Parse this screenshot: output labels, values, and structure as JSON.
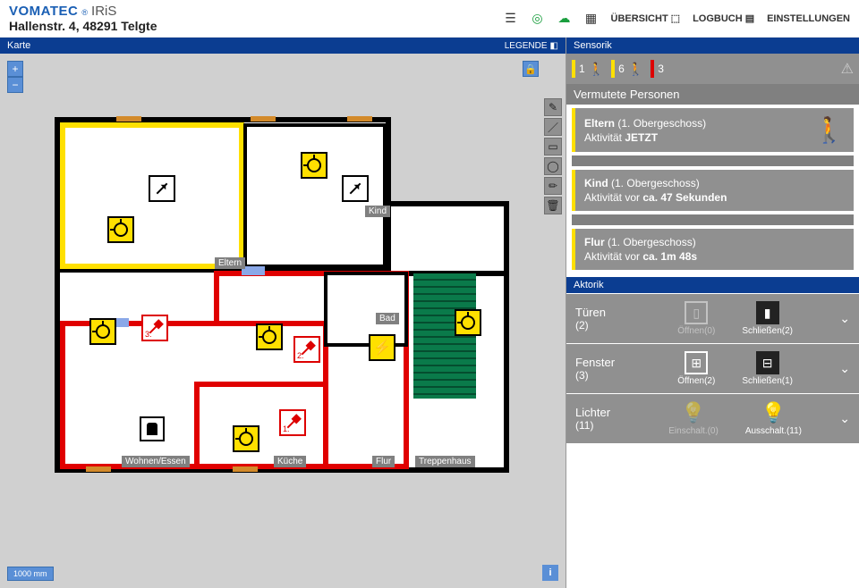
{
  "brand": {
    "main": "VOMATEC",
    "reg": "®",
    "sub": "IRiS"
  },
  "address": "Hallenstr. 4, 48291 Telgte",
  "nav": {
    "overview": "ÜBERSICHT",
    "logbook": "LOGBUCH",
    "settings": "EINSTELLUNGEN"
  },
  "map": {
    "title": "Karte",
    "legend": "LEGENDE",
    "scale": "1000 mm",
    "zoom_in": "+",
    "zoom_out": "−",
    "info": "i"
  },
  "rooms": {
    "eltern": "Eltern",
    "kind": "Kind",
    "bad": "Bad",
    "kueche": "Küche",
    "flur": "Flur",
    "wohnen": "Wohnen/Essen",
    "treppe": "Treppenhaus"
  },
  "detectors": {
    "d1": {
      "num": "1."
    },
    "d2": {
      "num": "2."
    },
    "d3": {
      "num": "3."
    }
  },
  "sensorik": {
    "title": "Sensorik",
    "seg1": "1",
    "seg2": "6",
    "seg3": "3",
    "sub": "Vermutete Personen",
    "cards": [
      {
        "name": "Eltern",
        "floor": "(1. Obergeschoss)",
        "act_label": "Aktivität",
        "act_val": "JETZT",
        "show_icon": true
      },
      {
        "name": "Kind",
        "floor": "(1. Obergeschoss)",
        "act_label": "Aktivität vor",
        "act_val": "ca. 47 Sekunden",
        "show_icon": false
      },
      {
        "name": "Flur",
        "floor": "(1. Obergeschoss)",
        "act_label": "Aktivität vor",
        "act_val": "ca. 1m 48s",
        "show_icon": false
      }
    ]
  },
  "aktorik": {
    "title": "Aktorik",
    "groups": [
      {
        "name": "Türen",
        "count": "(2)",
        "open": {
          "label": "Öffnen(0)",
          "dim": true
        },
        "close": {
          "label": "Schließen(2)",
          "dim": false
        }
      },
      {
        "name": "Fenster",
        "count": "(3)",
        "open": {
          "label": "Öffnen(2)",
          "dim": false
        },
        "close": {
          "label": "Schließen(1)",
          "dim": false
        }
      },
      {
        "name": "Lichter",
        "count": "(11)",
        "open": {
          "label": "Einschalt.(0)",
          "dim": true
        },
        "close": {
          "label": "Ausschalt.(11)",
          "dim": false
        }
      }
    ]
  }
}
